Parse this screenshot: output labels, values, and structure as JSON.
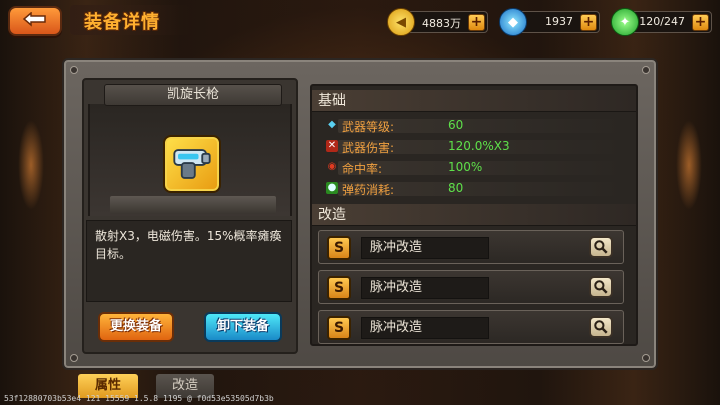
{
  "header": {
    "title": "装备详情"
  },
  "resources": [
    {
      "name": "gold",
      "value": "4883万",
      "icon": "gold-coin-icon",
      "color": "#f2b21c"
    },
    {
      "name": "gems",
      "value": "1937",
      "icon": "blue-gem-icon",
      "color": "#1e90e0"
    },
    {
      "name": "energy",
      "value": "120/247",
      "icon": "green-energy-icon",
      "color": "#2ec13a"
    }
  ],
  "item": {
    "name": "凯旋长枪",
    "icon": "weapon-gun-icon",
    "description": "散射X3，电磁伤害。15%概率瘫痪目标。"
  },
  "buttons": {
    "change": "更换装备",
    "unequip": "卸下装备"
  },
  "sections": {
    "basic": "基础",
    "modify": "改造"
  },
  "stats": [
    {
      "label": "武器等级:",
      "value": "60",
      "icon": "diamond-level-icon"
    },
    {
      "label": "武器伤害:",
      "value": "120.0%X3",
      "icon": "damage-icon"
    },
    {
      "label": "命中率:",
      "value": "100%",
      "icon": "target-icon"
    },
    {
      "label": "弹药消耗:",
      "value": "80",
      "icon": "ammo-icon"
    }
  ],
  "mods": [
    {
      "badge": "S",
      "name": "脉冲改造"
    },
    {
      "badge": "S",
      "name": "脉冲改造"
    },
    {
      "badge": "S",
      "name": "脉冲改造"
    }
  ],
  "tabs": {
    "attributes": "属性",
    "modify": "改造"
  },
  "debug_text": "53f12880703b53e4 121 15559 1.5.8 1195 @ f0d53e53505d7b3b"
}
